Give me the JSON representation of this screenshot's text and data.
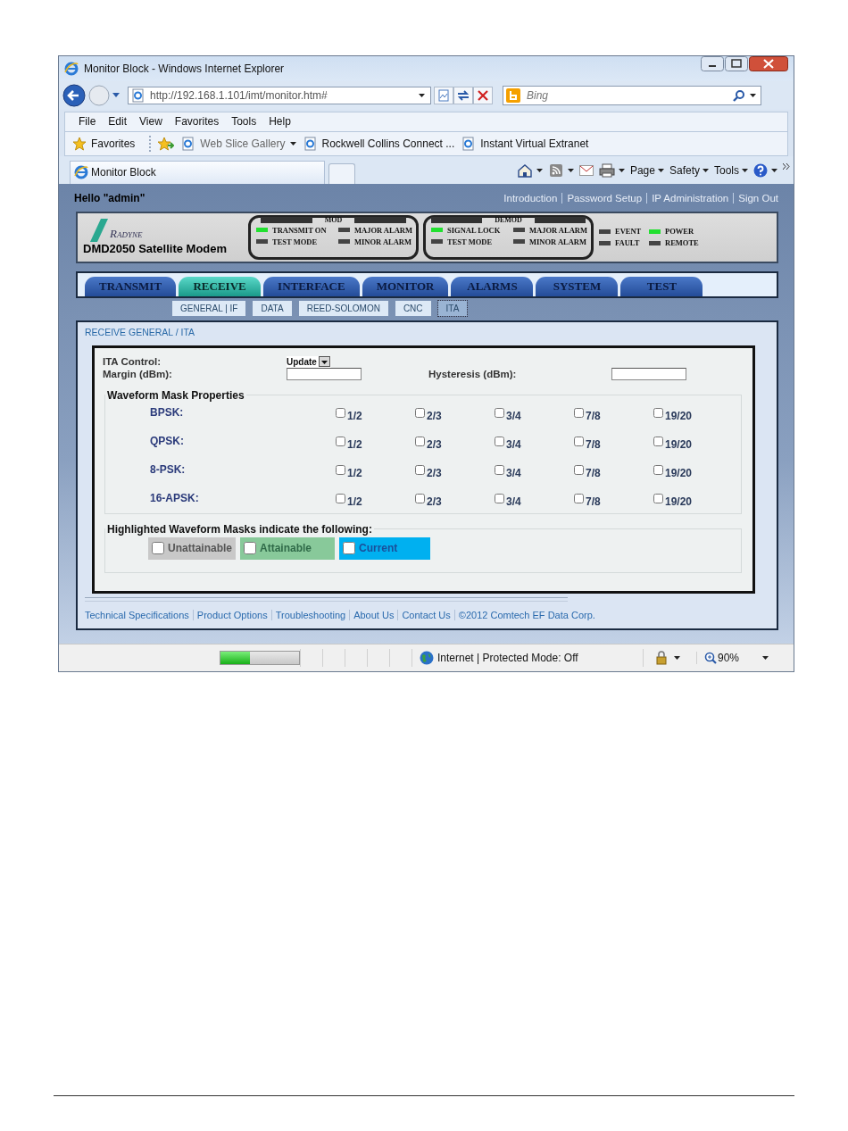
{
  "window": {
    "title": "Monitor Block - Windows Internet Explorer"
  },
  "address_bar": {
    "url": "http://192.168.1.101/imt/monitor.htm#"
  },
  "search": {
    "placeholder": "Bing"
  },
  "menu": [
    "File",
    "Edit",
    "View",
    "Favorites",
    "Tools",
    "Help"
  ],
  "favorites_bar": {
    "label": "Favorites",
    "links": [
      {
        "label": "Web Slice Gallery",
        "dropdown": true
      },
      {
        "label": "Rockwell Collins Connect ...",
        "dropdown": false
      },
      {
        "label": "Instant Virtual Extranet",
        "dropdown": false
      }
    ]
  },
  "tab": {
    "title": "Monitor Block"
  },
  "command_bar": [
    "Page",
    "Safety",
    "Tools"
  ],
  "page": {
    "greeting": "Hello \"admin\"",
    "top_links": [
      "Introduction",
      "Password Setup",
      "IP Administration",
      "Sign Out"
    ],
    "logo": "RADYNE",
    "product": "DMD2050 Satellite Modem",
    "indicator_groups": [
      {
        "title": "MOD",
        "leds": [
          {
            "label": "TRANSMIT ON",
            "on": true
          },
          {
            "label": "MAJOR ALARM",
            "on": false
          },
          {
            "label": "TEST MODE",
            "on": false
          },
          {
            "label": "MINOR ALARM",
            "on": false
          }
        ]
      },
      {
        "title": "DEMOD",
        "leds": [
          {
            "label": "SIGNAL LOCK",
            "on": true
          },
          {
            "label": "MAJOR ALARM",
            "on": false
          },
          {
            "label": "TEST MODE",
            "on": false
          },
          {
            "label": "MINOR ALARM",
            "on": false
          }
        ]
      }
    ],
    "indicators": [
      {
        "label": "EVENT",
        "on": false
      },
      {
        "label": "POWER",
        "on": true
      },
      {
        "label": "FAULT",
        "on": false
      },
      {
        "label": "REMOTE",
        "on": false
      }
    ],
    "nav_tabs": [
      {
        "label": "TRANSMIT",
        "selected": false
      },
      {
        "label": "RECEIVE",
        "selected": true
      },
      {
        "label": "INTERFACE",
        "selected": false
      },
      {
        "label": "MONITOR",
        "selected": false
      },
      {
        "label": "ALARMS",
        "selected": false
      },
      {
        "label": "SYSTEM",
        "selected": false
      },
      {
        "label": "TEST",
        "selected": false
      }
    ],
    "sub_tabs": [
      {
        "label": "GENERAL | IF",
        "selected": false
      },
      {
        "label": "DATA",
        "selected": false
      },
      {
        "label": "REED-SOLOMON",
        "selected": false
      },
      {
        "label": "CNC",
        "selected": false
      },
      {
        "label": "ITA",
        "selected": true
      }
    ],
    "breadcrumb": "RECEIVE GENERAL / ITA",
    "ita_control": {
      "label": "ITA Control:",
      "value": "Update"
    },
    "margin": {
      "label": "Margin (dBm):"
    },
    "hysteresis": {
      "label": "Hysteresis (dBm):"
    },
    "mask_properties": {
      "title": "Waveform Mask Properties",
      "rows": [
        {
          "label": "BPSK:",
          "options": [
            {
              "label": "1/2",
              "checked": false
            },
            {
              "label": "2/3",
              "checked": false
            },
            {
              "label": "3/4",
              "checked": false
            },
            {
              "label": "7/8",
              "checked": false
            },
            {
              "label": "19/20",
              "checked": false
            }
          ]
        },
        {
          "label": "QPSK:",
          "options": [
            {
              "label": "1/2",
              "checked": false
            },
            {
              "label": "2/3",
              "checked": false
            },
            {
              "label": "3/4",
              "checked": false
            },
            {
              "label": "7/8",
              "checked": false
            },
            {
              "label": "19/20",
              "checked": false
            }
          ]
        },
        {
          "label": "8-PSK:",
          "options": [
            {
              "label": "1/2",
              "checked": false
            },
            {
              "label": "2/3",
              "checked": false
            },
            {
              "label": "3/4",
              "checked": false
            },
            {
              "label": "7/8",
              "checked": false
            },
            {
              "label": "19/20",
              "checked": false
            }
          ]
        },
        {
          "label": "16-APSK:",
          "options": [
            {
              "label": "1/2",
              "checked": false
            },
            {
              "label": "2/3",
              "checked": false
            },
            {
              "label": "3/4",
              "checked": false
            },
            {
              "label": "7/8",
              "checked": false
            },
            {
              "label": "19/20",
              "checked": false
            }
          ]
        }
      ]
    },
    "legend": {
      "title": "Highlighted Waveform Masks indicate the following:",
      "items": [
        {
          "label": "Unattainable",
          "color": "#c8c8c8",
          "checked": false
        },
        {
          "label": "Attainable",
          "color": "#88c99a",
          "checked": false
        },
        {
          "label": "Current",
          "color": "#00b0f0",
          "checked": false
        }
      ]
    },
    "footer_links": [
      "Technical Specifications",
      "Product Options",
      "Troubleshooting",
      "About Us",
      "Contact Us",
      "©2012 Comtech EF Data Corp."
    ]
  },
  "status_bar": {
    "progress": {
      "level": 0.38
    },
    "zone": "Internet | Protected Mode: Off",
    "zoom": "90%"
  }
}
